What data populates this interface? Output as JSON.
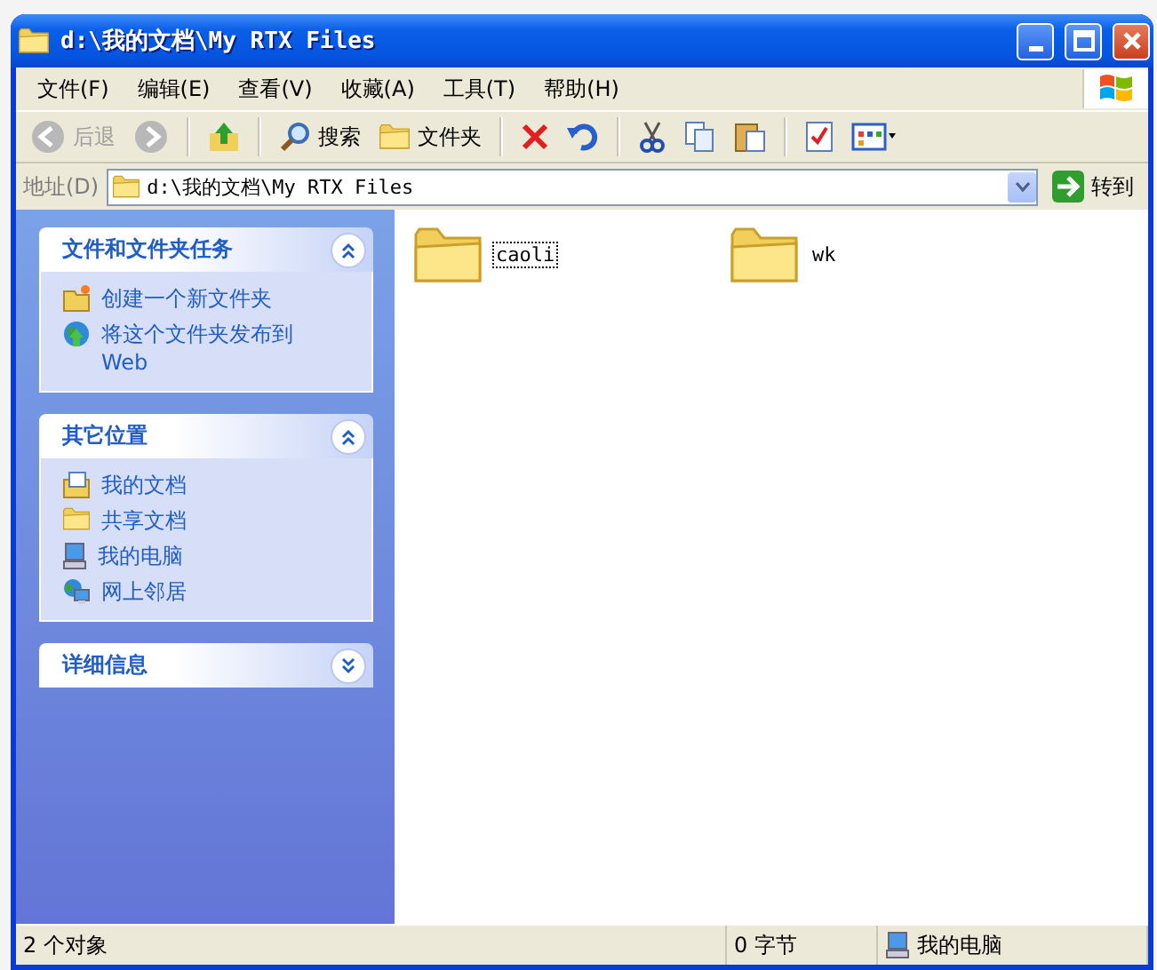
{
  "window": {
    "title": "d:\\我的文档\\My RTX Files"
  },
  "menu": [
    {
      "label": "文件(F)"
    },
    {
      "label": "编辑(E)"
    },
    {
      "label": "查看(V)"
    },
    {
      "label": "收藏(A)"
    },
    {
      "label": "工具(T)"
    },
    {
      "label": "帮助(H)"
    }
  ],
  "toolbar": [
    {
      "kind": "back",
      "label": "后退",
      "disabled": true
    },
    {
      "kind": "forward",
      "disabled": true
    },
    {
      "kind": "up"
    },
    {
      "kind": "search",
      "label": "搜索"
    },
    {
      "kind": "folders",
      "label": "文件夹"
    },
    {
      "kind": "delete"
    },
    {
      "kind": "undo"
    },
    {
      "kind": "cut"
    },
    {
      "kind": "copy"
    },
    {
      "kind": "paste"
    },
    {
      "kind": "properties"
    },
    {
      "kind": "views"
    }
  ],
  "address": {
    "label": "地址(D)",
    "value": "d:\\我的文档\\My RTX Files",
    "go": "转到"
  },
  "panels": [
    {
      "title": "文件和文件夹任务",
      "expanded": true,
      "items": [
        {
          "kind": "new-folder",
          "label": "创建一个新文件夹"
        },
        {
          "kind": "publish",
          "label": "将这个文件夹发布到 Web"
        }
      ]
    },
    {
      "title": "其它位置",
      "expanded": true,
      "items": [
        {
          "kind": "documents",
          "label": "我的文档"
        },
        {
          "kind": "folder",
          "label": "共享文档"
        },
        {
          "kind": "computer",
          "label": "我的电脑"
        },
        {
          "kind": "network",
          "label": "网上邻居"
        }
      ]
    },
    {
      "title": "详细信息",
      "expanded": false
    }
  ],
  "files": [
    {
      "name": "caoli",
      "focused": true
    },
    {
      "name": "wk",
      "focused": false
    }
  ],
  "status": {
    "objects": "2 个对象",
    "size": "0 字节",
    "zone": "我的电脑"
  }
}
